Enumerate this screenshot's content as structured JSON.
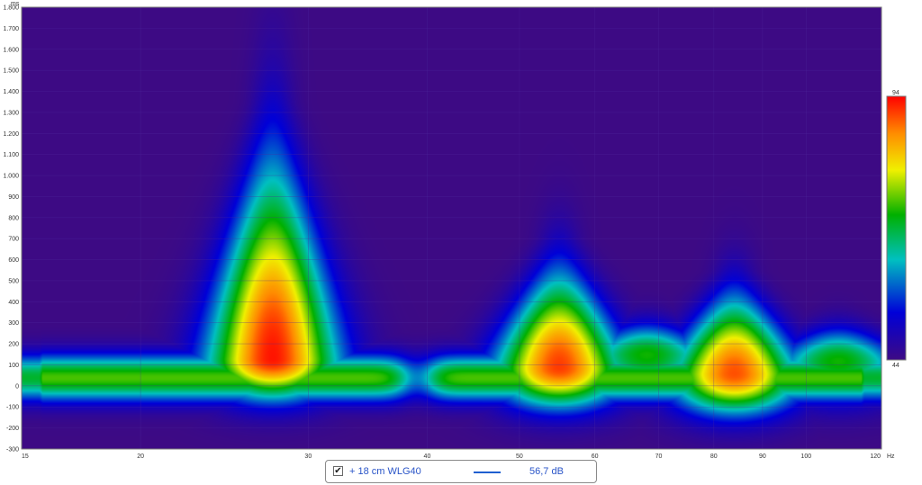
{
  "chart_data": {
    "type": "heatmap",
    "x_unit": "Hz",
    "y_unit": "ms",
    "x_scale": "log",
    "xlim": [
      15,
      120
    ],
    "ylim": [
      -300,
      1800
    ],
    "x_ticks": [
      15,
      20,
      30,
      40,
      50,
      60,
      70,
      80,
      90,
      100,
      120
    ],
    "x_tick_labels": [
      "15",
      "20",
      "30",
      "40",
      "50",
      "60",
      "70",
      "80",
      "90",
      "100",
      "120"
    ],
    "y_ticks": [
      -300,
      -200,
      -100,
      0,
      100,
      200,
      300,
      400,
      500,
      600,
      700,
      800,
      900,
      1000,
      1100,
      1200,
      1300,
      1400,
      1500,
      1600,
      1700,
      1800
    ],
    "y_tick_labels": [
      "-300",
      "-200",
      "-100",
      "0",
      "100",
      "200",
      "300",
      "400",
      "500",
      "600",
      "700",
      "800",
      "900",
      "1.000",
      "1.100",
      "1.200",
      "1.300",
      "1.400",
      "1.500",
      "1.600",
      "1.700",
      "1.800"
    ],
    "grid": true,
    "colorbar": {
      "min": 44,
      "max": 94,
      "min_label": "44",
      "max_label": "94"
    },
    "peaks": [
      {
        "freq_hz": 27.5,
        "time_ms": 130,
        "level_db": 93,
        "decay_ms": 1550
      },
      {
        "freq_hz": 55,
        "time_ms": 90,
        "level_db": 91,
        "decay_ms": 780
      },
      {
        "freq_hz": 68,
        "time_ms": 150,
        "level_db": 72,
        "decay_ms": 380
      },
      {
        "freq_hz": 84,
        "time_ms": 60,
        "level_db": 90,
        "decay_ms": 620
      },
      {
        "freq_hz": 108,
        "time_ms": 120,
        "level_db": 72,
        "decay_ms": 360
      }
    ],
    "baseline": {
      "time_ms": 40,
      "level_db": 74,
      "spread_ms": 110
    },
    "legend": {
      "checked": true,
      "series_name": "+ 18 cm WLG40",
      "value": "56,7 dB",
      "line_color": "#1f5fd0"
    },
    "background_color": "#3d0a84",
    "grid_color": "#4f2a9e"
  }
}
